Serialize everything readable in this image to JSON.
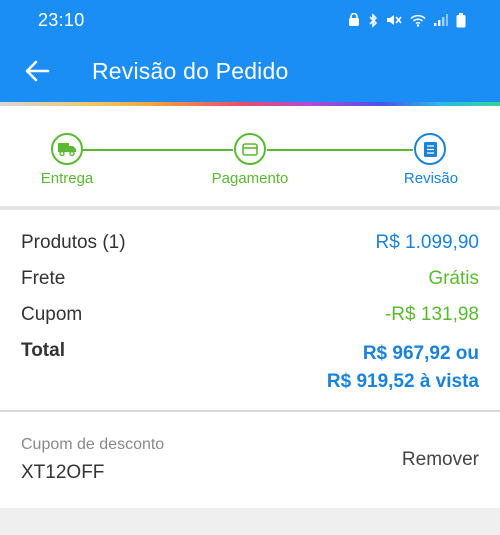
{
  "status_bar": {
    "time": "23:10",
    "icons": [
      "lock-icon",
      "bluetooth-icon",
      "mute-icon",
      "wifi-icon",
      "signal-icon",
      "battery-icon"
    ]
  },
  "app_bar": {
    "title": "Revisão do Pedido",
    "back_icon": "arrow-back-icon"
  },
  "colors": {
    "primary": "#1a8ef5",
    "accent_blue": "#1a82d9",
    "success_green": "#5bb832"
  },
  "stepper": {
    "steps": [
      {
        "label": "Entrega",
        "icon": "truck-icon",
        "state": "done"
      },
      {
        "label": "Pagamento",
        "icon": "card-icon",
        "state": "done"
      },
      {
        "label": "Revisão",
        "icon": "document-icon",
        "state": "current"
      }
    ]
  },
  "summary": {
    "products_label": "Produtos (1)",
    "products_value": "R$ 1.099,90",
    "shipping_label": "Frete",
    "shipping_value": "Grátis",
    "coupon_label": "Cupom",
    "coupon_value": "-R$ 131,98",
    "total_label": "Total",
    "total_value_line1": "R$ 967,92 ou",
    "total_value_line2": "R$ 919,52 à vista"
  },
  "coupon": {
    "label": "Cupom de desconto",
    "code": "XT12OFF",
    "remove_label": "Remover"
  }
}
